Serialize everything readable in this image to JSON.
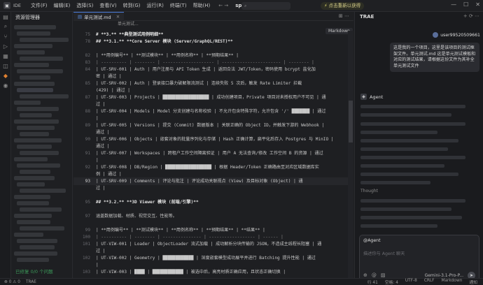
{
  "topbar": {
    "ide_label": "IDE",
    "menu": [
      "文件(F)",
      "编辑(E)",
      "选择(S)",
      "查看(V)",
      "转到(G)",
      "运行(R)",
      "终端(T)",
      "帮助(H)"
    ],
    "nav_arrows": "← →",
    "project": "speckle",
    "upgrade_text": "点击重新以获得",
    "window_controls": [
      "—",
      "☐",
      "✕"
    ]
  },
  "sidebar": {
    "title": "资源管理器",
    "status": "已修复 0/0 个问题"
  },
  "editor": {
    "tab_label": "单元测试.md",
    "breadcrumb": "单元测试...",
    "preview_label": "Markdown",
    "lines": [
      {
        "n": "75",
        "kind": "h3",
        "text": "# **3.** **典型测试用例明细**"
      },
      {
        "n": "78",
        "kind": "h4",
        "text": "## **3.1.** **Core Server 模块 (Server/GraphQL/REST)**"
      },
      {
        "n": "",
        "kind": "blank",
        "text": ""
      },
      {
        "n": "82",
        "kind": "row",
        "text": "| **用例编号** | **测试模块** | **用例名称**              | **预期结果**               |"
      },
      {
        "n": "83",
        "kind": "sep",
        "text": "| ---------- | -------- | -------------------- | ----------------------- | -------- |"
      },
      {
        "n": "84",
        "kind": "row",
        "text": "| UT-SRV-001  | Auth     | 用户注册与 API Token 生成  | 返回合法 JWT/Token，密码使用 bcrypt 盐化加"
      },
      {
        "n": "",
        "kind": "row",
        "text": "密 | 通过     |"
      },
      {
        "n": "85",
        "kind": "row",
        "text": "| UT-SRV-002  | Auth     | 登录接口暴力破解限流测试   | 连续失败 5 次后，触发 Rate Limiter 拦截"
      },
      {
        "n": "",
        "kind": "row",
        "text": "(429) | 通过     |"
      },
      {
        "n": "87",
        "kind": "row",
        "text": "| UT-SRV-003  | Projects | ██████████████████  | 成功创建项目，Private 项目对未授权用户不可见 | 通"
      },
      {
        "n": "",
        "kind": "row",
        "text": "过     |"
      },
      {
        "n": "88",
        "kind": "row",
        "text": "| UT-SRV-004  | Models   | Model 分支创建与名称校验    | 不允许包含特殊字符，允许包含 '/' ███████ | 通过"
      },
      {
        "n": "",
        "kind": "row",
        "text": "|"
      },
      {
        "n": "89",
        "kind": "row",
        "text": "| UT-SRV-005  | Versions | 提交 (Commit) 数据版本     | 关联正确的 Object ID，并触发下游的 Webhook |"
      },
      {
        "n": "",
        "kind": "row",
        "text": "通过 |"
      },
      {
        "n": "90",
        "kind": "row",
        "text": "| UT-SRV-006  | Objects  | 嵌套对象的批量序列化与存储  | Hash 正确计算，扁平化后存入 Postgres 与 MinIO |"
      },
      {
        "n": "",
        "kind": "row",
        "text": "通过    |"
      },
      {
        "n": "91",
        "kind": "row",
        "text": "| UT-SRV-007  | Workspaces | 跨租户工作空间隔离验证     | 用户 A 无法查询/修改 工作空间 B 的资源 | 通过"
      },
      {
        "n": "",
        "kind": "row",
        "text": "|"
      },
      {
        "n": "92",
        "kind": "row",
        "text": "| UT-SRV-008  | DB/Region | ██████████████████ | 根据 Header/Token 正确路由至对应区域数据库实"
      },
      {
        "n": "",
        "kind": "row",
        "text": "例 | 通过     |"
      },
      {
        "n": "93",
        "kind": "cur",
        "text": "| UT-SRV-009  | Comments | 评论与批注 | 评论成功关联视点 (View) 及目标对象 (Object) | 通"
      },
      {
        "n": "",
        "kind": "row",
        "text": "过     |"
      },
      {
        "n": "",
        "kind": "blank",
        "text": ""
      },
      {
        "n": "95",
        "kind": "h4",
        "text": "## **3.2.** **3D Viewer 模块 (前端/引擎)**"
      },
      {
        "n": "",
        "kind": "blank",
        "text": ""
      },
      {
        "n": "97",
        "kind": "plain",
        "text": "涵盖数据加载、材质、视觉交互、性能等。"
      },
      {
        "n": "",
        "kind": "blank",
        "text": ""
      },
      {
        "n": "99",
        "kind": "row",
        "text": "| **用例编号** | **测试模块** | **用例名称**       | **预期结果**          | **结果** |"
      },
      {
        "n": "100",
        "kind": "sep",
        "text": "| ---------- | -------- | --------------- | ------------------ | ------ |"
      },
      {
        "n": "101",
        "kind": "row",
        "text": "| UT-VIW-001  | Loader   | ObjectLoader 流式加载  | 成功解析分块传输的 JSON，不造成主线程长阻塞 | 通"
      },
      {
        "n": "",
        "kind": "row",
        "text": "过     |"
      },
      {
        "n": "102",
        "kind": "row",
        "text": "| UT-VIW-002  | Geometry | ████████████  | 深度嵌套模型成功展平并进行 Batching 提升性能 | 通过"
      },
      {
        "n": "",
        "kind": "row",
        "text": "|"
      },
      {
        "n": "103",
        "kind": "row",
        "text": "| UT-VIW-003  | ████     | ████████████  | 被选中后，高亮材质正确应用，且状态正确切换 |"
      }
    ]
  },
  "trae": {
    "title": "TRAE",
    "username": "user995205096​61",
    "message": "这是我的一个项目，这里是该项目的测试框架文件。单元测试.md 这是单元测试模板和对应的测试结果，请根据这份文件为其补全单元测试文件",
    "agent_label": "Agent",
    "thought_label": "Thought",
    "input_mention": "@Agent",
    "input_placeholder": "描述你与 Agent 聊天",
    "model_label": "Gemini-3.1-Pro-P..."
  },
  "statusbar": {
    "left": [
      "⊗ 0  ⚠ 0",
      "TRAE"
    ],
    "right": [
      "行 41",
      "空格: 4",
      "UTF-8",
      "CRLF",
      "Markdown",
      "通知"
    ]
  }
}
